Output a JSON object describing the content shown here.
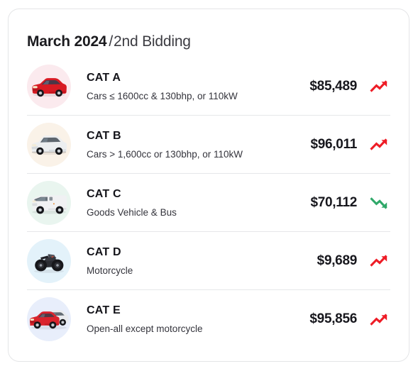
{
  "card": {
    "header": {
      "month": "March 2024",
      "separator": "/",
      "phase": "2nd Bidding"
    },
    "colors": {
      "trend_up": "#ee1c26",
      "trend_down": "#2fa869",
      "price_text": "#17171d",
      "card_border": "#e4e5e7",
      "row_divider": "#e6e7e9"
    },
    "rows": [
      {
        "name": "CAT A",
        "description": "Cars ≤ 1600cc & 130bhp, or 110kW",
        "price": "$85,489",
        "trend": "up",
        "trend_icon": "trending-up-icon",
        "vehicle_icon": "red-sedan-icon",
        "avatar_color": "#fbeaee"
      },
      {
        "name": "CAT B",
        "description": "Cars > 1,600cc or 130bhp, or 110kW",
        "price": "$96,011",
        "trend": "up",
        "trend_icon": "trending-up-icon",
        "vehicle_icon": "white-suv-icon",
        "avatar_color": "#faf2e8"
      },
      {
        "name": "CAT C",
        "description": "Goods Vehicle & Bus",
        "price": "$70,112",
        "trend": "down",
        "trend_icon": "trending-down-icon",
        "vehicle_icon": "white-van-icon",
        "avatar_color": "#e9f5ef"
      },
      {
        "name": "CAT D",
        "description": "Motorcycle",
        "price": "$9,689",
        "trend": "up",
        "trend_icon": "trending-up-icon",
        "vehicle_icon": "motorcycle-icon",
        "avatar_color": "#e3f2fa"
      },
      {
        "name": "CAT E",
        "description": "Open-all except motorcycle",
        "price": "$95,856",
        "trend": "up",
        "trend_icon": "trending-up-icon",
        "vehicle_icon": "two-cars-icon",
        "avatar_color": "#e8eefb"
      }
    ]
  }
}
